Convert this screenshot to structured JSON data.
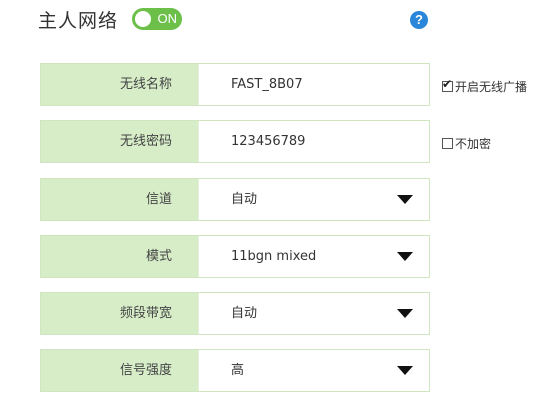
{
  "header": {
    "title": "主人网络",
    "toggle_label": "ON",
    "help_label": "?"
  },
  "colors": {
    "label_bg": "#d6edc7",
    "toggle_on": "#6cc04a",
    "help": "#2a86d8"
  },
  "fields": {
    "ssid": {
      "label": "无线名称",
      "value": "FAST_8B07"
    },
    "password": {
      "label": "无线密码",
      "value": "123456789"
    },
    "channel": {
      "label": "信道",
      "value": "自动"
    },
    "mode": {
      "label": "模式",
      "value": "11bgn mixed"
    },
    "bandwidth": {
      "label": "频段带宽",
      "value": "自动"
    },
    "strength": {
      "label": "信号强度",
      "value": "高"
    }
  },
  "options": {
    "broadcast": {
      "label": "开启无线广播",
      "checked": true,
      "mark": "✔"
    },
    "no_encrypt": {
      "label": "不加密",
      "checked": false,
      "mark": ""
    }
  }
}
